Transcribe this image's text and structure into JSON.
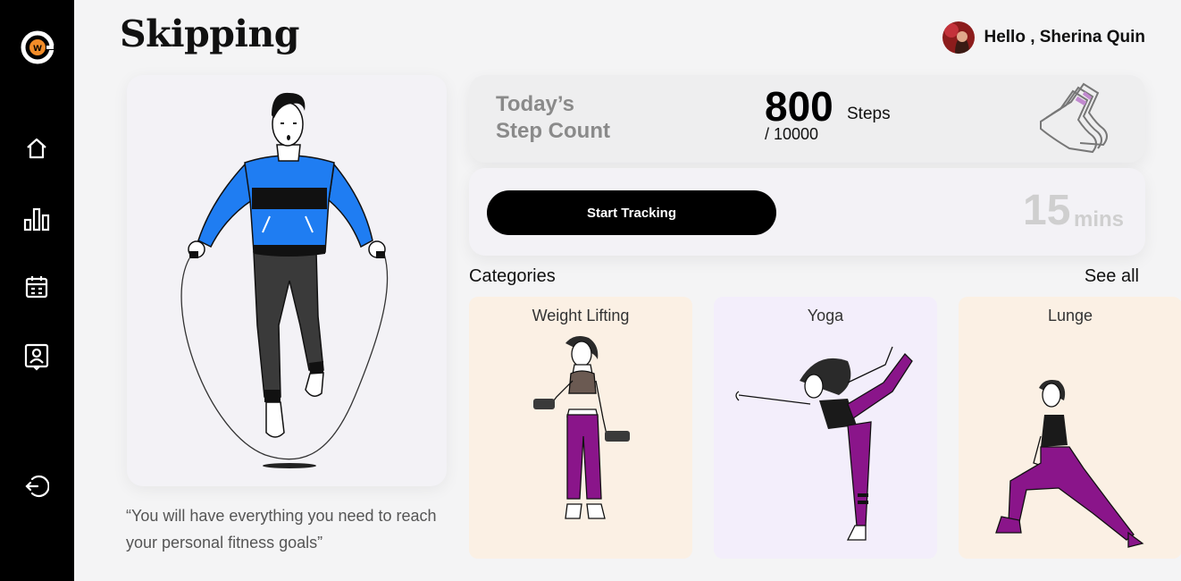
{
  "app": {
    "logo_letter": "w"
  },
  "sidebar": {
    "items": [
      {
        "name": "home",
        "icon": "home-icon"
      },
      {
        "name": "stats",
        "icon": "bar-chart-icon"
      },
      {
        "name": "calendar",
        "icon": "calendar-icon"
      },
      {
        "name": "profile",
        "icon": "contact-icon"
      },
      {
        "name": "logout",
        "icon": "logout-icon"
      }
    ]
  },
  "header": {
    "title": "Skipping",
    "greeting": "Hello , Sherina Quin"
  },
  "hero": {
    "quote": "“You will have everything you need to reach your personal fitness goals”"
  },
  "steps": {
    "label_line1": "Today’s",
    "label_line2": "Step Count",
    "count": "800",
    "unit": "Steps",
    "goal": "/ 10000"
  },
  "tracking": {
    "button_label": "Start Tracking",
    "duration_value": "15",
    "duration_unit": "mins"
  },
  "categories": {
    "title": "Categories",
    "see_all": "See all",
    "items": [
      {
        "label": "Weight Lifting",
        "bg": "#fbf0e4"
      },
      {
        "label": "Yoga",
        "bg": "#f3eefb"
      },
      {
        "label": "Lunge",
        "bg": "#fbf0e4"
      }
    ]
  },
  "colors": {
    "sidebar": "#000000",
    "accent_orange": "#f28c28",
    "sweater_blue": "#1f7df2",
    "purple": "#8a158a"
  }
}
